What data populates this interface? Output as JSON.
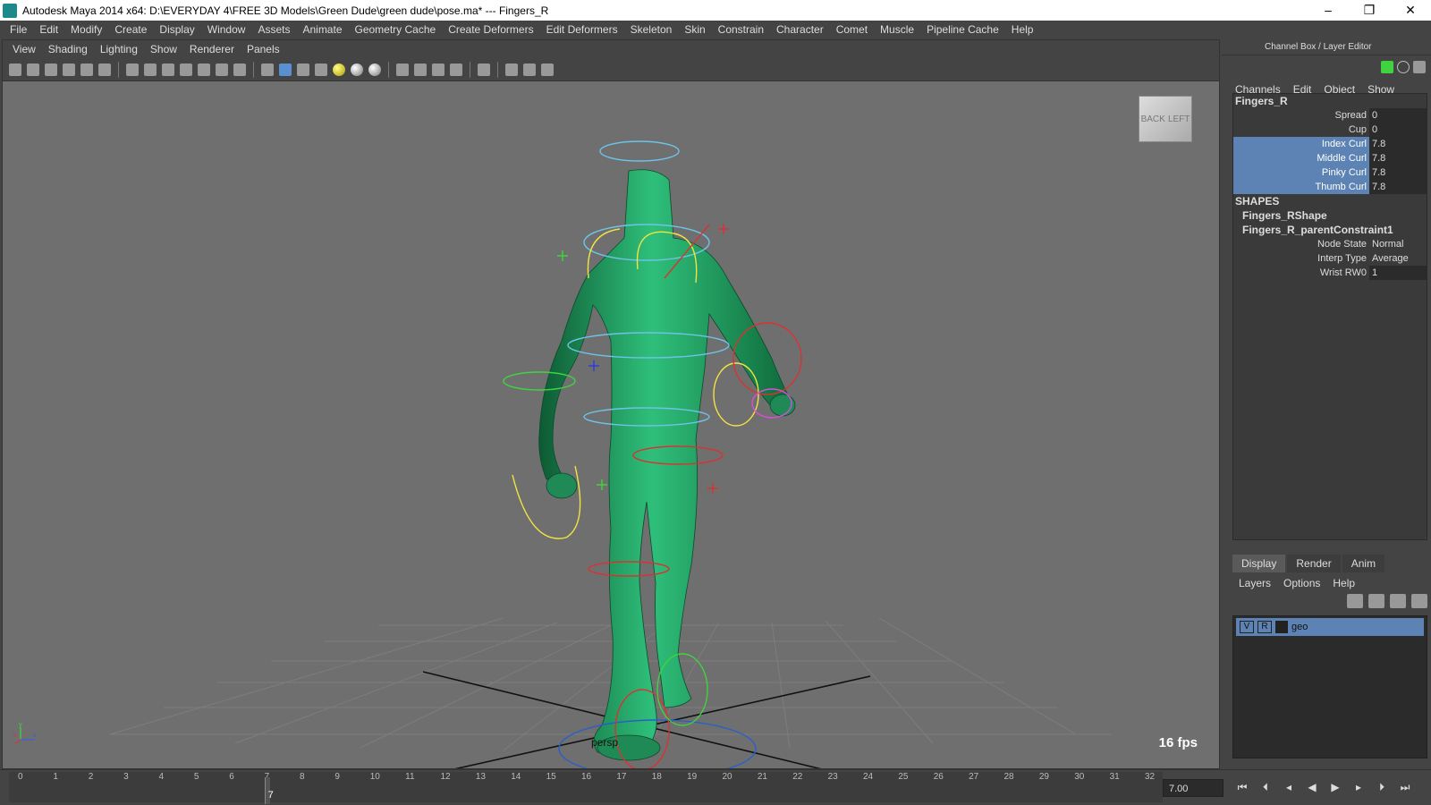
{
  "window": {
    "title": "Autodesk Maya 2014 x64: D:\\EVERYDAY 4\\FREE 3D Models\\Green Dude\\green dude\\pose.ma*  ---  Fingers_R",
    "minimize": "–",
    "maximize": "❐",
    "close": "✕"
  },
  "main_menu": [
    "File",
    "Edit",
    "Modify",
    "Create",
    "Display",
    "Window",
    "Assets",
    "Animate",
    "Geometry Cache",
    "Create Deformers",
    "Edit Deformers",
    "Skeleton",
    "Skin",
    "Constrain",
    "Character",
    "Comet",
    "Muscle",
    "Pipeline Cache",
    "Help"
  ],
  "viewport": {
    "menu": [
      "View",
      "Shading",
      "Lighting",
      "Show",
      "Renderer",
      "Panels"
    ],
    "camera": "persp",
    "fps": "16 fps",
    "viewcube": {
      "face1": "BACK",
      "face2": "LEFT"
    },
    "axis_x": "x",
    "axis_y": "y",
    "axis_z": "z",
    "body_color": "#1f8a55"
  },
  "channel_box": {
    "title": "Channel Box / Layer Editor",
    "menu": [
      "Channels",
      "Edit",
      "Object",
      "Show"
    ],
    "node": "Fingers_R",
    "attributes": [
      {
        "label": "Spread",
        "value": "0",
        "selected": false
      },
      {
        "label": "Cup",
        "value": "0",
        "selected": false
      },
      {
        "label": "Index Curl",
        "value": "7.8",
        "selected": true
      },
      {
        "label": "Middle Curl",
        "value": "7.8",
        "selected": true
      },
      {
        "label": "Pinky Curl",
        "value": "7.8",
        "selected": true
      },
      {
        "label": "Thumb Curl",
        "value": "7.8",
        "selected": true
      }
    ],
    "shapes_header": "SHAPES",
    "shape": "Fingers_RShape",
    "constraint": "Fingers_R_parentConstraint1",
    "constraint_attributes": [
      {
        "label": "Node State",
        "value": "Normal"
      },
      {
        "label": "Interp Type",
        "value": "Average"
      },
      {
        "label": "Wrist RW0",
        "value": "1"
      }
    ]
  },
  "layer_editor": {
    "tabs": [
      "Display",
      "Render",
      "Anim"
    ],
    "active_tab": "Display",
    "menu": [
      "Layers",
      "Options",
      "Help"
    ],
    "layers": [
      {
        "v": "V",
        "r": "R",
        "name": "geo"
      }
    ]
  },
  "timeline": {
    "ticks": [
      "0",
      "1",
      "2",
      "3",
      "4",
      "5",
      "6",
      "7",
      "8",
      "9",
      "10",
      "11",
      "12",
      "13",
      "14",
      "15",
      "16",
      "17",
      "18",
      "19",
      "20",
      "21",
      "22",
      "23",
      "24",
      "25",
      "26",
      "27",
      "28",
      "29",
      "30",
      "31",
      "32"
    ],
    "current_frame": "7",
    "current_time": "7.00"
  }
}
